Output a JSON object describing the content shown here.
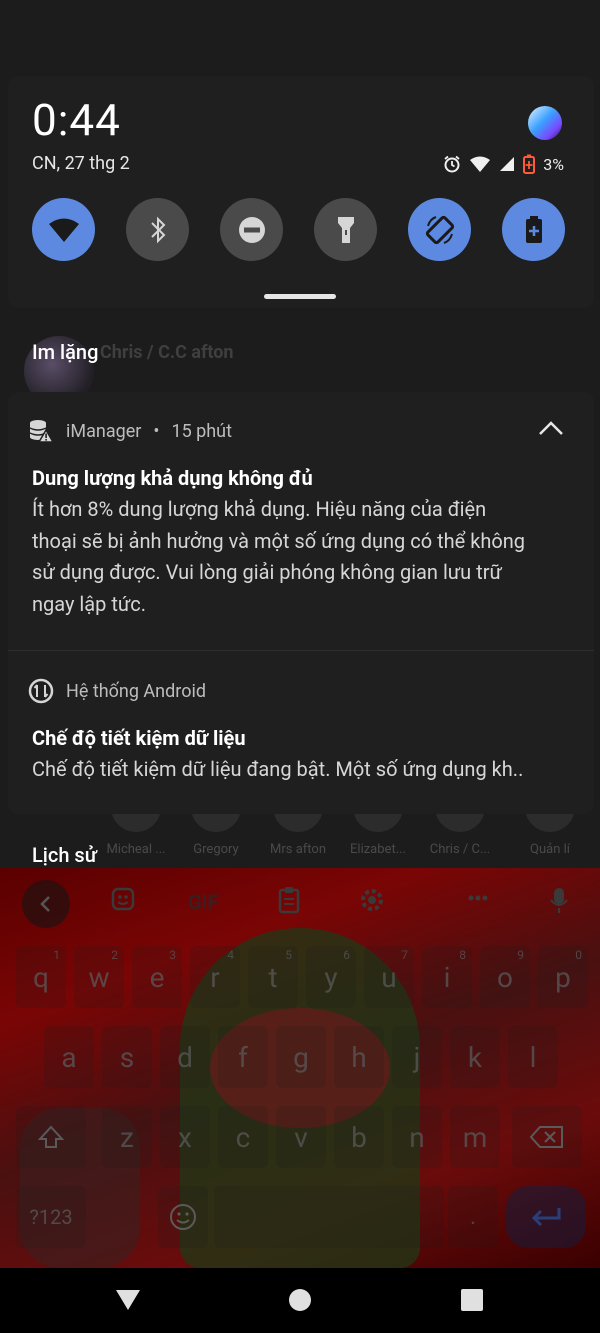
{
  "quick_settings": {
    "time": "0:44",
    "date": "CN, 27 thg 2",
    "battery_text": "3%",
    "tiles": [
      {
        "name": "wifi",
        "on": true
      },
      {
        "name": "bluetooth",
        "on": false
      },
      {
        "name": "do-not-disturb",
        "on": false
      },
      {
        "name": "flashlight",
        "on": false
      },
      {
        "name": "auto-rotate",
        "on": true
      },
      {
        "name": "battery-saver",
        "on": true
      }
    ]
  },
  "sections": {
    "silent": "Im lặng",
    "history": "Lịch sử"
  },
  "background": {
    "chat_name": "Chris / C.C afton",
    "contacts": [
      "Micheal ...",
      "Gregory",
      "Mrs afton",
      "Elizabet...",
      "Chris / C...",
      "Quản lí"
    ]
  },
  "notifications": [
    {
      "app": "iManager",
      "time": "15 phút",
      "title": "Dung lượng khả dụng không đủ",
      "body_lines": [
        "Ít hơn 8% dung lượng khả dụng. Hiệu năng của điện",
        "thoại sẽ bị ảnh hưởng và một số ứng dụng có thể không",
        "sử dụng được. Vui lòng giải phóng không gian lưu trữ",
        "ngay lập tức."
      ]
    },
    {
      "app": "Hệ thống Android",
      "title": "Chế độ tiết kiệm dữ liệu",
      "body": "Chế độ tiết kiệm dữ liệu đang bật. Một số ứng dụng kh.."
    }
  ],
  "keyboard": {
    "toolbar_gif": "GIF",
    "row1": [
      "q",
      "w",
      "e",
      "r",
      "t",
      "y",
      "u",
      "i",
      "o",
      "p"
    ],
    "row1_nums": [
      "1",
      "2",
      "3",
      "4",
      "5",
      "6",
      "7",
      "8",
      "9",
      "0"
    ],
    "row2": [
      "a",
      "s",
      "d",
      "f",
      "g",
      "h",
      "j",
      "k",
      "l"
    ],
    "row3": [
      "z",
      "x",
      "c",
      "v",
      "b",
      "n",
      "m"
    ],
    "symbols_key": "?123",
    "period_key": "."
  },
  "colors": {
    "tile_on": "#5d8ae0",
    "tile_off": "#4a4a4a",
    "panel": "#1f1f1f",
    "battery_low": "#ff5a3c"
  }
}
